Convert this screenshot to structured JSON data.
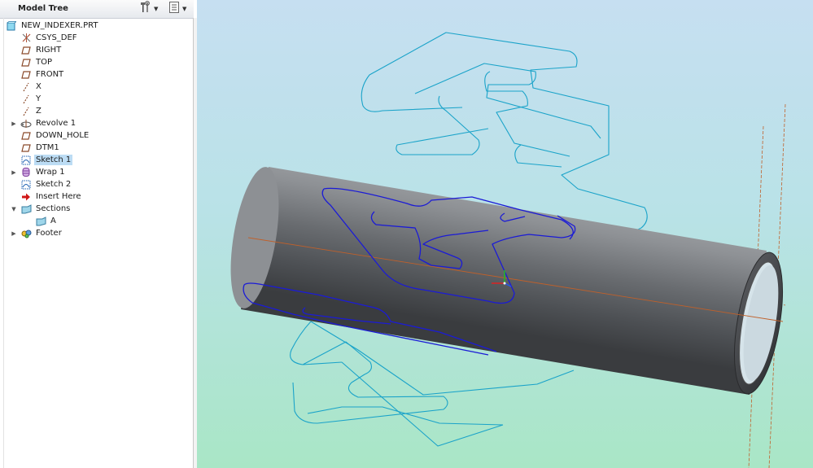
{
  "tree": {
    "title": "Model Tree",
    "root": "NEW_INDEXER.PRT",
    "items": [
      {
        "label": "CSYS_DEF"
      },
      {
        "label": "RIGHT"
      },
      {
        "label": "TOP"
      },
      {
        "label": "FRONT"
      },
      {
        "label": "X"
      },
      {
        "label": "Y"
      },
      {
        "label": "Z"
      },
      {
        "label": "Revolve 1"
      },
      {
        "label": "DOWN_HOLE"
      },
      {
        "label": "DTM1"
      },
      {
        "label": "Sketch 1"
      },
      {
        "label": "Wrap 1"
      },
      {
        "label": "Sketch 2"
      },
      {
        "label": "Insert Here"
      },
      {
        "label": "Sections"
      },
      {
        "label": "A"
      },
      {
        "label": "Footer"
      }
    ]
  },
  "colors": {
    "sketch_cyan": "#1aa3c9",
    "wrap_blue": "#1b1bd6",
    "axis_orange": "#c0602a",
    "selection": "#bcdcf4"
  }
}
